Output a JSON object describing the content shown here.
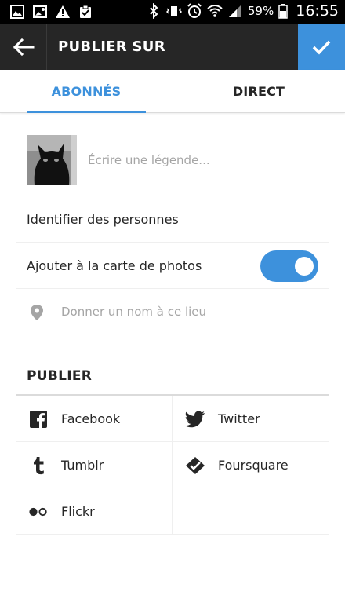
{
  "status_bar": {
    "battery_pct": "59%",
    "time": "16:55"
  },
  "header": {
    "title": "PUBLIER SUR"
  },
  "tabs": [
    {
      "label": "ABONNÉS",
      "active": true
    },
    {
      "label": "DIRECT",
      "active": false
    }
  ],
  "caption": {
    "placeholder": "Écrire une légende..."
  },
  "options": {
    "tag_people": "Identifier des personnes",
    "photo_map": "Ajouter à la carte de photos",
    "photo_map_enabled": true,
    "location_placeholder": "Donner un nom à ce lieu"
  },
  "share": {
    "title": "PUBLIER",
    "services": [
      {
        "label": "Facebook",
        "icon": "facebook-icon"
      },
      {
        "label": "Twitter",
        "icon": "twitter-icon"
      },
      {
        "label": "Tumblr",
        "icon": "tumblr-icon"
      },
      {
        "label": "Foursquare",
        "icon": "foursquare-icon"
      },
      {
        "label": "Flickr",
        "icon": "flickr-icon"
      }
    ]
  },
  "colors": {
    "accent": "#3d91dc",
    "header_bg": "#262626",
    "text": "#262626",
    "placeholder": "#a5a5a5"
  }
}
